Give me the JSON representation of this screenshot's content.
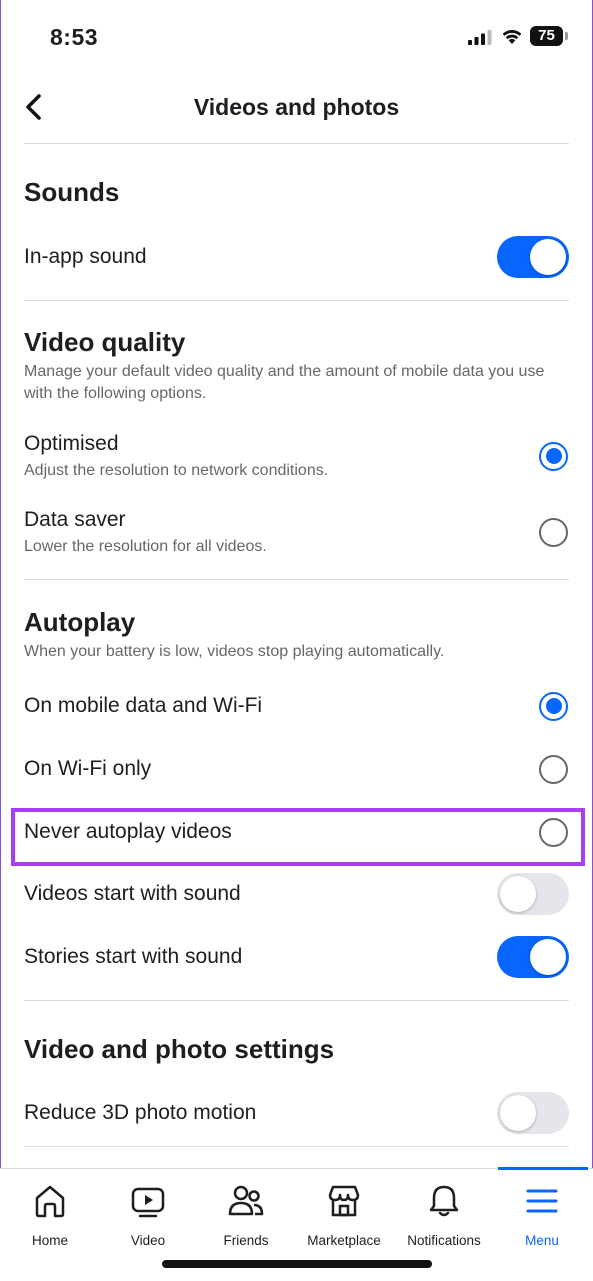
{
  "status_bar": {
    "time": "8:53",
    "battery": "75"
  },
  "nav": {
    "title": "Videos and photos"
  },
  "sounds": {
    "title": "Sounds",
    "in_app_sound": "In-app sound"
  },
  "video_quality": {
    "title": "Video quality",
    "description": "Manage your default video quality and the amount of mobile data you use with the following options.",
    "options": [
      {
        "label": "Optimised",
        "sub": "Adjust the resolution to network conditions.",
        "selected": true
      },
      {
        "label": "Data saver",
        "sub": "Lower the resolution for all videos.",
        "selected": false
      }
    ]
  },
  "autoplay": {
    "title": "Autoplay",
    "description": "When your battery is low, videos stop playing automatically.",
    "options": [
      {
        "label": "On mobile data and Wi-Fi",
        "selected": true
      },
      {
        "label": "On Wi-Fi only",
        "selected": false
      },
      {
        "label": "Never autoplay videos",
        "selected": false
      }
    ],
    "videos_start_with_sound": "Videos start with sound",
    "stories_start_with_sound": "Stories start with sound"
  },
  "photo_settings": {
    "title": "Video and photo settings",
    "reduce_3d_motion": "Reduce 3D photo motion"
  },
  "tabs": [
    {
      "label": "Home",
      "icon": "home-icon"
    },
    {
      "label": "Video",
      "icon": "video-icon"
    },
    {
      "label": "Friends",
      "icon": "friends-icon"
    },
    {
      "label": "Marketplace",
      "icon": "marketplace-icon"
    },
    {
      "label": "Notifications",
      "icon": "bell-icon"
    },
    {
      "label": "Menu",
      "icon": "menu-icon"
    }
  ],
  "colors": {
    "accent": "#0866ff",
    "highlight": "#a93ff0",
    "toggle_off": "#e4e6eb"
  }
}
